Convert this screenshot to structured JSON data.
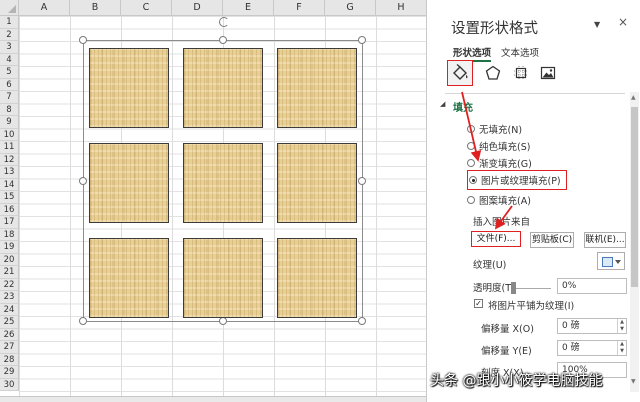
{
  "sheet": {
    "columns": [
      "A",
      "B",
      "C",
      "D",
      "E",
      "F",
      "G",
      "H"
    ],
    "rows": [
      "1",
      "2",
      "3",
      "4",
      "5",
      "6",
      "7",
      "8",
      "9",
      "10",
      "11",
      "12",
      "13",
      "14",
      "15",
      "16",
      "17",
      "18",
      "19",
      "20",
      "21",
      "22",
      "23",
      "24",
      "25",
      "26",
      "27",
      "28",
      "29",
      "30"
    ]
  },
  "shapes": {
    "tile_count": 9,
    "fill": "papyrus texture"
  },
  "pane": {
    "title": "设置形状格式",
    "close_glyph": "×",
    "caret_glyph": "▼",
    "tabs": [
      "形状选项",
      "文本选项"
    ],
    "icons": [
      "fill-bucket-icon",
      "pentagon-icon",
      "size-properties-icon",
      "picture-icon"
    ],
    "section_title": "填充",
    "fill_options": [
      {
        "label": "无填充(N)",
        "selected": false
      },
      {
        "label": "纯色填充(S)",
        "selected": false
      },
      {
        "label": "渐变填充(G)",
        "selected": false
      },
      {
        "label": "图片或纹理填充(P)",
        "selected": true
      },
      {
        "label": "图案填充(A)",
        "selected": false
      }
    ],
    "insert_picture_label": "插入图片来自",
    "buttons": {
      "file": "文件(F)...",
      "clipboard": "剪贴板(C)",
      "online": "联机(E)..."
    },
    "texture_label": "纹理(U)",
    "transparency_label": "透明度(T)",
    "transparency_value": "0%",
    "tile_checkbox_label": "将图片平铺为纹理(I)",
    "offset_x_label": "偏移量 X(O)",
    "offset_x_value": "0 磅",
    "offset_y_label": "偏移量 Y(E)",
    "offset_y_value": "0 磅",
    "scale_x_label": "刻度 X(X)",
    "scale_x_value": "100%"
  },
  "accent_color": "#1e7145",
  "highlight_color": "#e02020",
  "watermark": "头条 @跟小小筱学电脑技能"
}
